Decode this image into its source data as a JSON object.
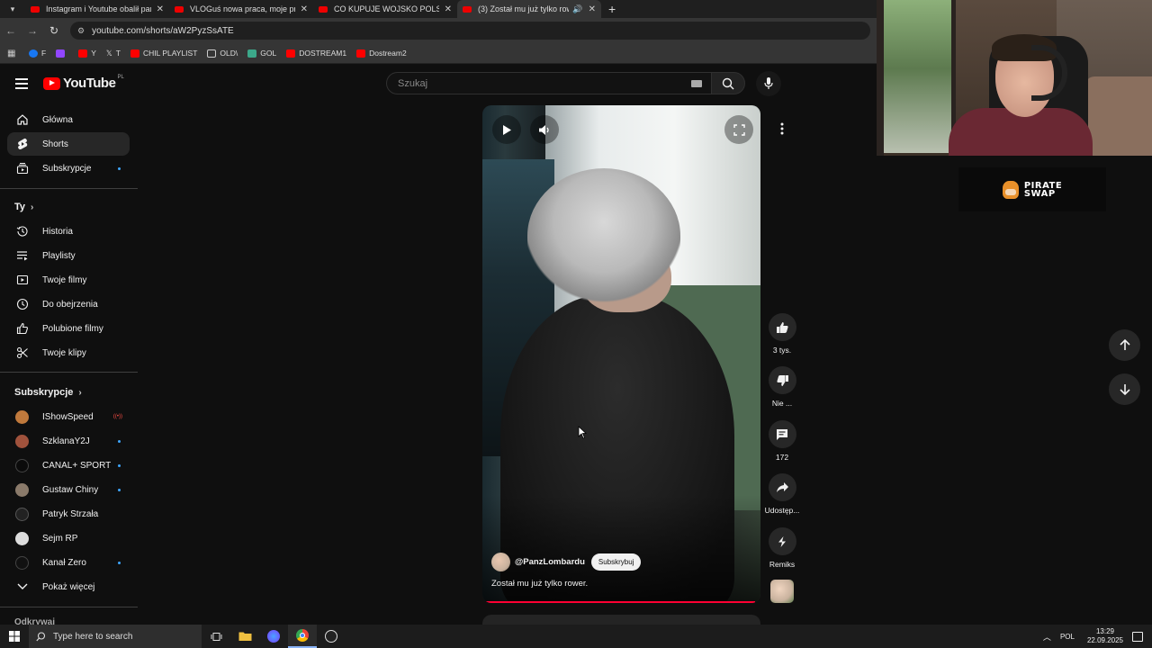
{
  "browser": {
    "tabs": [
      {
        "title": "Instagram i Youtube obalił pańs",
        "active": false
      },
      {
        "title": "VLOGuś nowa praca, moje prze",
        "active": false
      },
      {
        "title": "CO KUPUJE WOJSKO POLSKIE?",
        "active": false
      },
      {
        "title": "(3) Został mu już tylko rowe",
        "active": true
      }
    ],
    "url": "youtube.com/shorts/aW2PyzSsATE",
    "bookmarks": [
      {
        "label": "F",
        "color": "#1877f2"
      },
      {
        "label": "",
        "color": "#9146ff"
      },
      {
        "label": "Y",
        "color": "#ff0000"
      },
      {
        "label": "T",
        "color": "#dddddd"
      },
      {
        "label": "CHIL PLAYLIST",
        "color": "#ff0000"
      },
      {
        "label": "OLD\\",
        "color": "#cccccc"
      },
      {
        "label": "GOL",
        "color": "#3ca88a"
      },
      {
        "label": "DOSTREAM1",
        "color": "#ff0000"
      },
      {
        "label": "Dostream2",
        "color": "#ff0000"
      }
    ]
  },
  "youtube": {
    "logo_text": "YouTube",
    "country_code": "PL",
    "search_placeholder": "Szukaj",
    "sidebar": {
      "main": [
        {
          "label": "Główna",
          "icon": "home-icon"
        },
        {
          "label": "Shorts",
          "icon": "shorts-icon",
          "active": true
        },
        {
          "label": "Subskrypcje",
          "icon": "subscriptions-icon"
        }
      ],
      "you_heading": "Ty",
      "you": [
        {
          "label": "Historia",
          "icon": "history-icon"
        },
        {
          "label": "Playlisty",
          "icon": "playlist-icon"
        },
        {
          "label": "Twoje filmy",
          "icon": "your-videos-icon"
        },
        {
          "label": "Do obejrzenia",
          "icon": "watch-later-icon"
        },
        {
          "label": "Polubione filmy",
          "icon": "liked-icon"
        },
        {
          "label": "Twoje klipy",
          "icon": "clips-icon"
        }
      ],
      "subs_heading": "Subskrypcje",
      "subscriptions": [
        {
          "label": "IShowSpeed",
          "status": "live",
          "color": "#c0793c"
        },
        {
          "label": "SzklanaY2J",
          "status": "dot",
          "color": "#a0523c"
        },
        {
          "label": "CANAL+ SPORT",
          "status": "dot",
          "color": "#0b0b0b"
        },
        {
          "label": "Gustaw Chiny",
          "status": "dot",
          "color": "#8a7a6a"
        },
        {
          "label": "Patryk Strzała",
          "status": "none",
          "color": "#222222"
        },
        {
          "label": "Sejm RP",
          "status": "none",
          "color": "#dddddd"
        },
        {
          "label": "Kanał Zero",
          "status": "dot",
          "color": "#111111"
        }
      ],
      "show_more": "Pokaż więcej",
      "cut_off_heading": "Odkrywaj"
    },
    "short": {
      "channel": "@PanzLombardu",
      "subscribe_label": "Subskrybuj",
      "caption": "Został mu już tylko rower.",
      "progress": 0.98
    },
    "actions": [
      {
        "label": "3 tys.",
        "icon": "like-icon"
      },
      {
        "label": "Nie ...",
        "icon": "dislike-icon"
      },
      {
        "label": "172",
        "icon": "comments-icon"
      },
      {
        "label": "Udostęp...",
        "icon": "share-icon"
      },
      {
        "label": "Remiks",
        "icon": "remix-icon"
      }
    ]
  },
  "overlay": {
    "sponsor_line1": "PIRATE",
    "sponsor_line2": "SWAP"
  },
  "taskbar": {
    "search_placeholder": "Type here to search",
    "language": "POL",
    "time": "13:29",
    "date": "22.09.2025"
  }
}
